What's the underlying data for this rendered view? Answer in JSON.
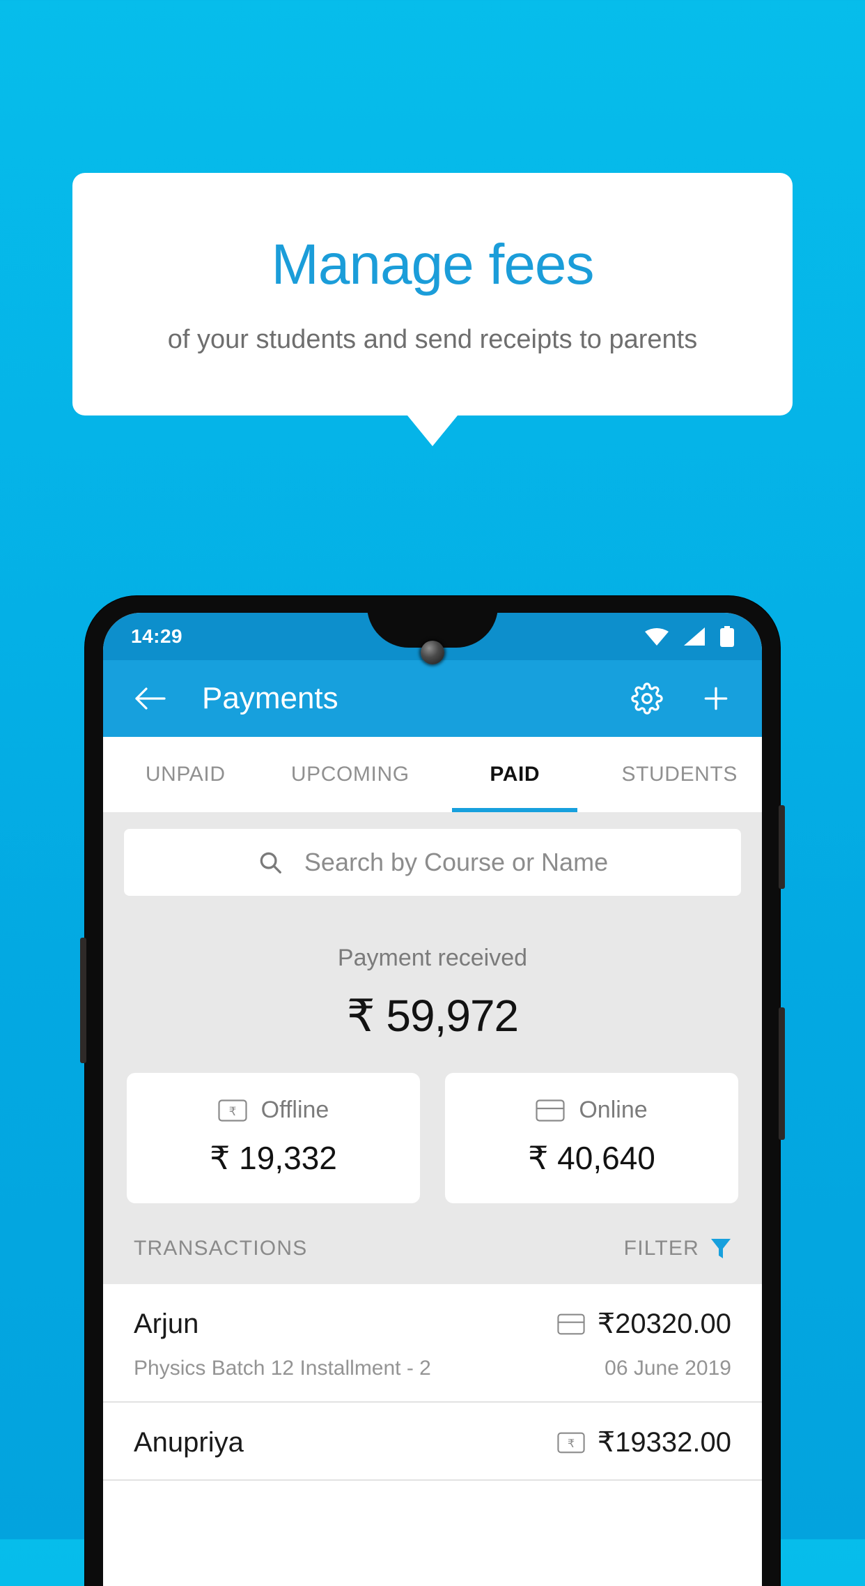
{
  "promo": {
    "title": "Manage fees",
    "subtitle": "of your students and send receipts to parents",
    "title_color": "#1b9dd9",
    "background_color": "#05b4e8"
  },
  "status_bar": {
    "time": "14:29",
    "icons": [
      "wifi-icon",
      "signal-icon",
      "battery-icon"
    ]
  },
  "app_bar": {
    "back_label": "",
    "title": "Payments",
    "settings_icon": "gear-icon",
    "add_icon": "plus-icon",
    "color": "#17a0dd"
  },
  "tabs": [
    {
      "label": "UNPAID",
      "active": false
    },
    {
      "label": "UPCOMING",
      "active": false
    },
    {
      "label": "PAID",
      "active": true
    },
    {
      "label": "STUDENTS",
      "active": false
    }
  ],
  "search": {
    "placeholder": "Search by Course or Name",
    "value": "",
    "icon": "search-icon"
  },
  "summary": {
    "label": "Payment received",
    "amount": "₹ 59,972",
    "breakdown": [
      {
        "label": "Offline",
        "amount": "₹ 19,332",
        "icon": "rupee-note-icon"
      },
      {
        "label": "Online",
        "amount": "₹ 40,640",
        "icon": "credit-card-icon"
      }
    ]
  },
  "transactions_header": {
    "title": "TRANSACTIONS",
    "filter_label": "FILTER",
    "filter_icon": "funnel-icon",
    "filter_color": "#17a0dd"
  },
  "transactions": [
    {
      "name": "Arjun",
      "amount": "₹20320.00",
      "method_icon": "credit-card-icon",
      "description": "Physics Batch 12 Installment - 2",
      "date": "06 June 2019"
    },
    {
      "name": "Anupriya",
      "amount": "₹19332.00",
      "method_icon": "rupee-note-icon",
      "description": "",
      "date": ""
    }
  ]
}
